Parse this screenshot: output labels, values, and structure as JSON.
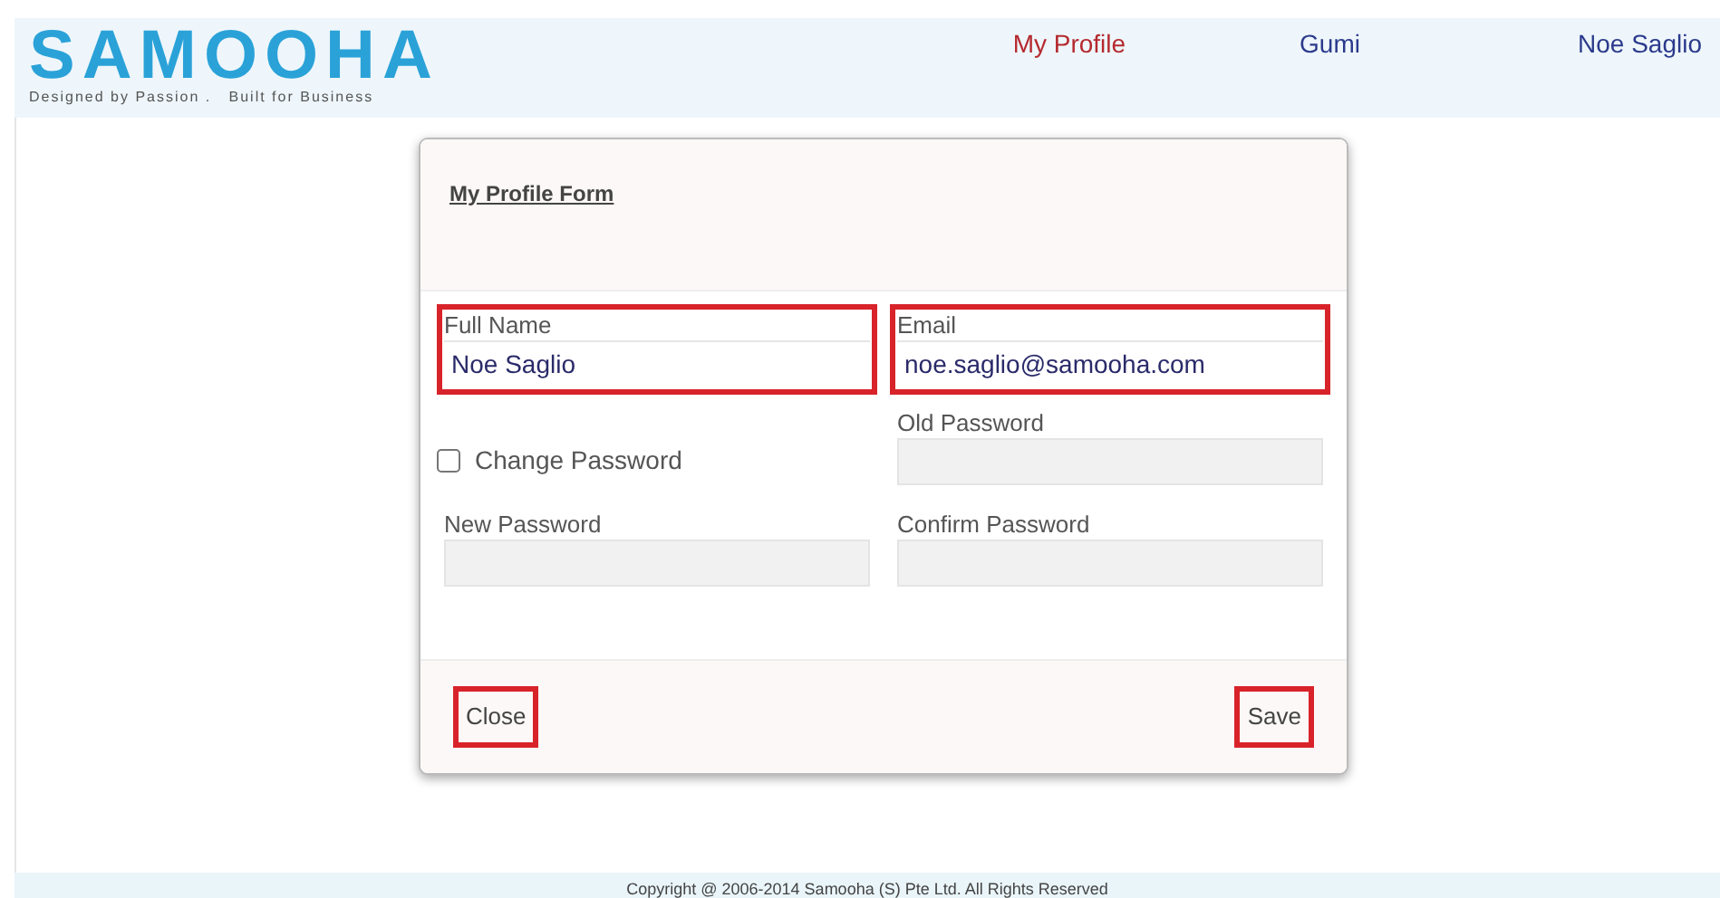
{
  "header": {
    "logo": "SAMOOHA",
    "tagline": "Designed by Passion .   Built for Business",
    "nav": [
      {
        "label": "My Profile",
        "selected": true
      },
      {
        "label": "Gumi",
        "selected": false
      },
      {
        "label": "Noe Saglio",
        "selected": false
      }
    ]
  },
  "modal": {
    "title": "My Profile Form",
    "fields": [
      {
        "kind": "text",
        "label": "Full Name",
        "value": "Noe Saglio",
        "highlighted": true,
        "disabled": false
      },
      {
        "kind": "text",
        "label": "Email",
        "value": "noe.saglio@samooha.com",
        "highlighted": true,
        "disabled": false
      },
      {
        "kind": "checkbox",
        "label": "Change Password",
        "checked": false
      },
      {
        "kind": "text",
        "label": "Old Password",
        "highlighted": false,
        "disabled": true
      },
      {
        "kind": "text",
        "label": "New Password",
        "highlighted": false,
        "disabled": true
      },
      {
        "kind": "text",
        "label": "Confirm Password",
        "highlighted": false,
        "disabled": true
      }
    ],
    "buttons": [
      {
        "label": "Close",
        "highlighted": true
      },
      {
        "label": "Save",
        "highlighted": true
      }
    ]
  },
  "footer": "Copyright @ 2006-2014 Samooha (S) Pte Ltd. All Rights Reserved"
}
